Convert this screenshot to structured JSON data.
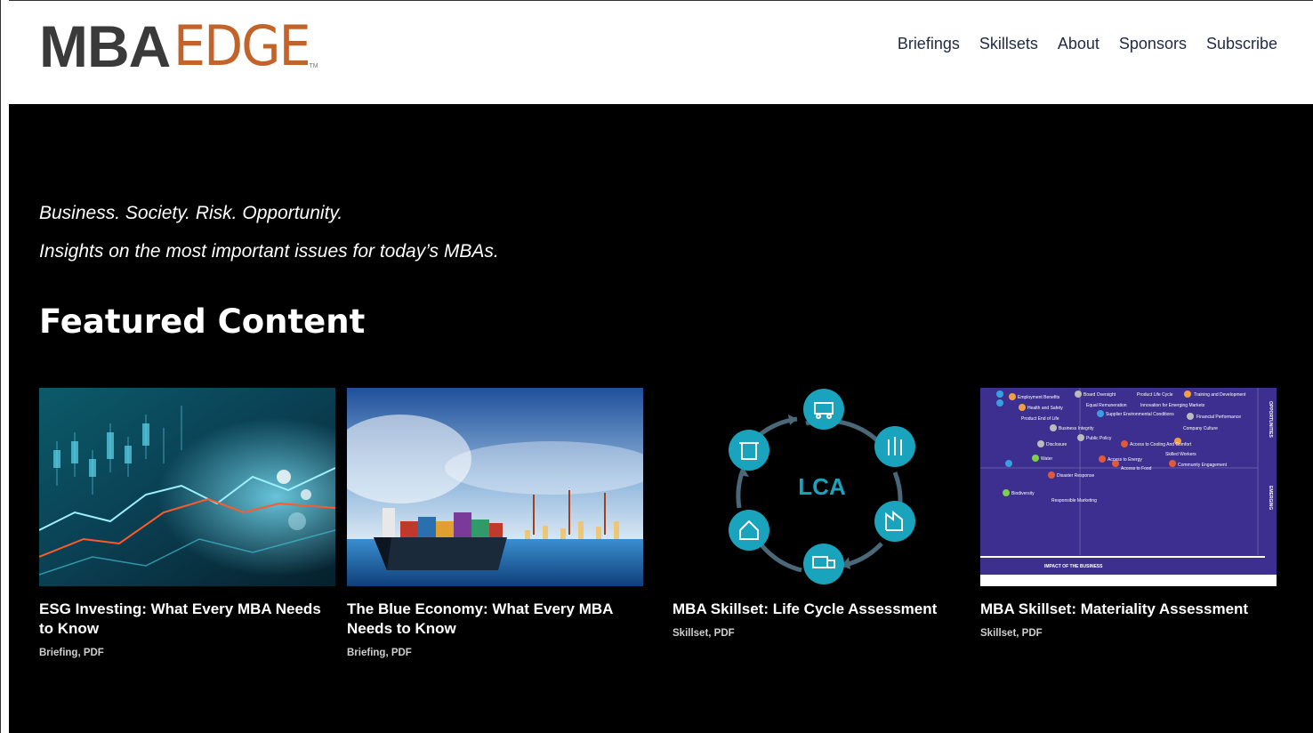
{
  "header": {
    "logo_mba": "MBA",
    "logo_edge": "EDGE",
    "logo_tm": "TM",
    "nav": [
      "Briefings",
      "Skillsets",
      "About",
      "Sponsors",
      "Subscribe"
    ]
  },
  "hero": {
    "tagline1": "Business. Society. Risk. Opportunity.",
    "tagline2": "Insights on the most important issues for today’s MBAs.",
    "section_title": "Featured Content"
  },
  "cards": [
    {
      "title": "ESG Investing: What Every MBA Needs to Know",
      "meta": "Briefing, PDF",
      "image": "financial-chart-image"
    },
    {
      "title": "The Blue Economy: What Every MBA Needs to Know",
      "meta": "Briefing, PDF",
      "image": "cargo-ship-image"
    },
    {
      "title": "MBA Skillset: Life Cycle Assessment",
      "meta": "Skillset, PDF",
      "image": "lca-cycle-diagram"
    },
    {
      "title": "MBA Skillset: Materiality Assessment",
      "meta": "Skillset, PDF",
      "image": "materiality-matrix-image"
    }
  ],
  "lca_label": "LCA",
  "materiality": {
    "labels": [
      "Employment Benefits",
      "Board Oversight",
      "Product Life Cycle",
      "Training and Development",
      "Health and Safety",
      "Equal Remuneration",
      "Innovation for Emerging Markets",
      "Product End of Life",
      "Supplier Environmental Conditions",
      "Financial Performance",
      "Business Integrity",
      "Company Culture",
      "Public Policy",
      "Disclosure",
      "Access to Cooling And Comfort",
      "Water",
      "Access to Energy",
      "Skilled Workers",
      "Access to Food",
      "Community Engagement",
      "Disaster Response",
      "Biodiversity",
      "Responsible Marketing"
    ],
    "axis_x": "IMPACT OF THE BUSINESS",
    "axis_y1": "OPPORTUNITIES",
    "axis_y2": "EMERGING"
  },
  "colors": {
    "logo_grey": "#3a3a3a",
    "logo_orange": "#c2632a",
    "nav": "#1f2a44",
    "lca_teal": "#1aa3bd",
    "matrix_purple": "#3d2f8f"
  }
}
